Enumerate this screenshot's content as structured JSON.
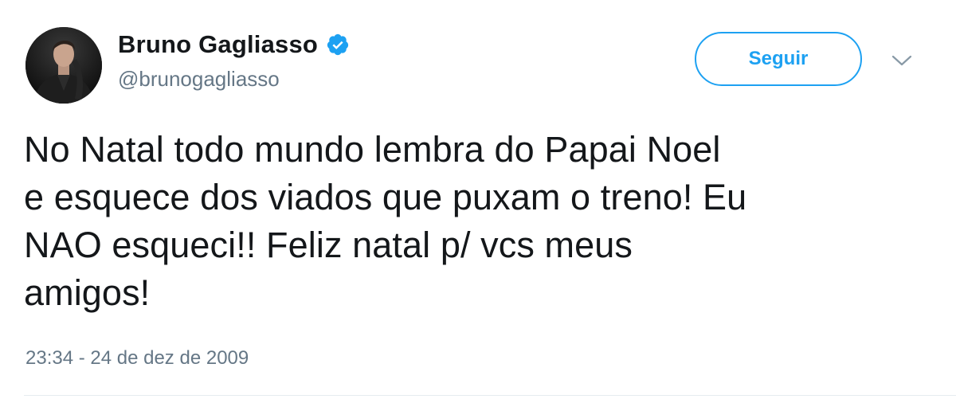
{
  "tweet": {
    "author": {
      "display_name": "Bruno Gagliasso",
      "handle": "@brunogagliasso",
      "verified": true,
      "verified_icon": "verified-badge-icon"
    },
    "follow_label": "Seguir",
    "menu_icon": "chevron-down-icon",
    "lines": [
      "No Natal todo mundo lembra do Papai Noel",
      "e esquece dos viados que puxam o treno! Eu",
      "NAO esqueci!! Feliz natal p/ vcs meus",
      "amigos!"
    ],
    "timestamp": "23:34 - 24 de dez de 2009"
  },
  "colors": {
    "accent": "#1da1f2",
    "text": "#14171a",
    "muted": "#657786",
    "divider": "#e6ecf0"
  }
}
